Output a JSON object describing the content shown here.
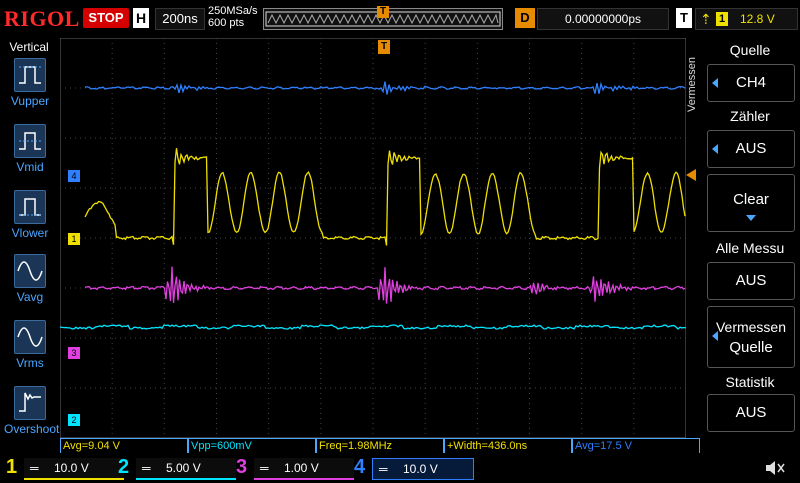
{
  "topbar": {
    "logo": "RIGOL",
    "run_state": "STOP",
    "h_label": "H",
    "timebase": "200ns",
    "sample_rate": "250MSa/s",
    "memory_depth": "600 pts",
    "trigger_marker": "T",
    "d_label": "D",
    "delay": "0.00000000ps",
    "t_label": "T",
    "trigger_source": "1",
    "trigger_level": "12.8 V"
  },
  "leftbar": {
    "title": "Vertical",
    "items": [
      {
        "label": "Vupper",
        "icon": "vupper-icon"
      },
      {
        "label": "Vmid",
        "icon": "vmid-icon"
      },
      {
        "label": "Vlower",
        "icon": "vlower-icon"
      },
      {
        "label": "Vavg",
        "icon": "vavg-icon"
      },
      {
        "label": "Vrms",
        "icon": "vrms-icon"
      },
      {
        "label": "Overshoot",
        "icon": "overshoot-icon"
      }
    ]
  },
  "screen": {
    "channel_markers": [
      "4",
      "1",
      "3",
      "2"
    ],
    "trigger_pos_marker": "T"
  },
  "rightbar": {
    "side_label": "Vermessen",
    "items": [
      {
        "title": "Quelle",
        "value": "CH4"
      },
      {
        "title": "Zähler",
        "value": "AUS"
      },
      {
        "title": "",
        "value": "Clear"
      },
      {
        "title": "Alle Messu",
        "value": "AUS"
      },
      {
        "title": "",
        "value": "Vermessen",
        "value2": "Quelle"
      },
      {
        "title": "Statistik",
        "value": "AUS"
      }
    ]
  },
  "measurements": [
    {
      "text": "Avg=9.04 V",
      "color": "#f0e000"
    },
    {
      "text": "Vpp=600mV",
      "color": "#00e5ff"
    },
    {
      "text": "Freq=1.98MHz",
      "color": "#f0e000"
    },
    {
      "text": "+Width=436.0ns",
      "color": "#f0e000"
    },
    {
      "text": "Avg=17.5 V",
      "color": "#2f7fff"
    }
  ],
  "channels": [
    {
      "num": "1",
      "scale": "10.0 V",
      "color": "#f0e000"
    },
    {
      "num": "2",
      "scale": "5.00 V",
      "color": "#00e5ff"
    },
    {
      "num": "3",
      "scale": "1.00 V",
      "color": "#e040e0"
    },
    {
      "num": "4",
      "scale": "10.0 V",
      "color": "#2f7fff"
    }
  ],
  "colors": {
    "ch1": "#f0e000",
    "ch2": "#00e5ff",
    "ch3": "#e040e0",
    "ch4": "#2f7fff",
    "accent": "#4aa6ff",
    "stop": "#d40000",
    "trigger": "#e68a00"
  }
}
